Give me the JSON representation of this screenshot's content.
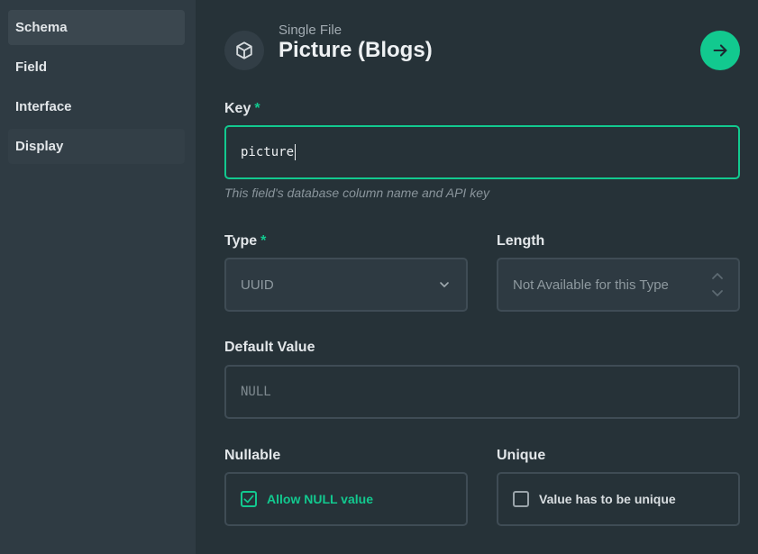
{
  "sidebar": {
    "items": [
      {
        "label": "Schema"
      },
      {
        "label": "Field"
      },
      {
        "label": "Interface"
      },
      {
        "label": "Display"
      }
    ]
  },
  "header": {
    "subtitle": "Single File",
    "title": "Picture (Blogs)",
    "icon": "cube-icon",
    "action_icon": "arrow-right-icon"
  },
  "form": {
    "key": {
      "label": "Key",
      "required": "*",
      "value": "picture",
      "hint": "This field's database column name and API key"
    },
    "type": {
      "label": "Type",
      "required": "*",
      "value": "UUID"
    },
    "length": {
      "label": "Length",
      "placeholder": "Not Available for this Type"
    },
    "default_value": {
      "label": "Default Value",
      "placeholder": "NULL"
    },
    "nullable": {
      "label": "Nullable",
      "checkbox_label": "Allow NULL value",
      "checked": true
    },
    "unique": {
      "label": "Unique",
      "checkbox_label": "Value has to be unique",
      "checked": false
    }
  },
  "colors": {
    "accent": "#12c98f",
    "background": "#263238",
    "sidebar": "#2f3b43"
  }
}
